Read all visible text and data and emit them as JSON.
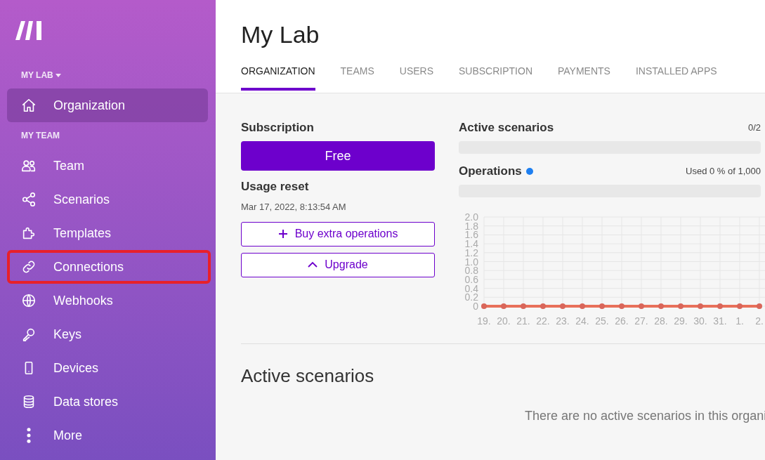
{
  "sidebar": {
    "org_label": "MY LAB",
    "team_label": "MY TEAM",
    "org_items": [
      {
        "label": "Organization",
        "selected": true,
        "highlighted": false
      }
    ],
    "team_items": [
      {
        "label": "Team",
        "selected": false,
        "highlighted": false
      },
      {
        "label": "Scenarios",
        "selected": false,
        "highlighted": false
      },
      {
        "label": "Templates",
        "selected": false,
        "highlighted": false
      },
      {
        "label": "Connections",
        "selected": false,
        "highlighted": true
      },
      {
        "label": "Webhooks",
        "selected": false,
        "highlighted": false
      },
      {
        "label": "Keys",
        "selected": false,
        "highlighted": false
      },
      {
        "label": "Devices",
        "selected": false,
        "highlighted": false
      },
      {
        "label": "Data stores",
        "selected": false,
        "highlighted": false
      },
      {
        "label": "More",
        "selected": false,
        "highlighted": false
      }
    ]
  },
  "page": {
    "title": "My Lab",
    "tabs": [
      {
        "label": "ORGANIZATION",
        "selected": true
      },
      {
        "label": "TEAMS",
        "selected": false
      },
      {
        "label": "USERS",
        "selected": false
      },
      {
        "label": "SUBSCRIPTION",
        "selected": false
      },
      {
        "label": "PAYMENTS",
        "selected": false
      },
      {
        "label": "INSTALLED APPS",
        "selected": false
      }
    ]
  },
  "subscription": {
    "heading": "Subscription",
    "plan": "Free",
    "reset_heading": "Usage reset",
    "reset_time": "Mar 17, 2022, 8:13:54 AM",
    "buttons": [
      {
        "label": "Buy extra operations",
        "kind": "plus"
      },
      {
        "label": "Upgrade",
        "kind": "caret"
      }
    ]
  },
  "active_scenarios_meter": {
    "label": "Active scenarios",
    "reading": "0/2",
    "level": 0
  },
  "operations_meter": {
    "label": "Operations",
    "reading": "Used 0 % of 1,000",
    "level": 0,
    "chart_data": {
      "type": "line",
      "categories": [
        "19.",
        "20.",
        "21.",
        "22.",
        "23.",
        "24.",
        "25.",
        "26.",
        "27.",
        "28.",
        "29.",
        "30.",
        "31.",
        "1.",
        "2."
      ],
      "grid": true,
      "series": [
        {
          "color": "#e8705a",
          "marker": true,
          "values": [
            0,
            0,
            0,
            0,
            0,
            0,
            0,
            0,
            0,
            0,
            0,
            0,
            0,
            0,
            0
          ]
        }
      ],
      "ylim": [
        0,
        2
      ],
      "yticks": [
        0,
        0.2,
        0.4,
        0.6,
        0.8,
        {
          "value": 1,
          "label": "1.0"
        },
        1.2,
        1.4,
        1.6,
        1.8,
        {
          "value": 2,
          "label": "2.0"
        }
      ]
    }
  },
  "active_scenarios": {
    "heading": "Active scenarios",
    "empty_message": "There are no active scenarios in this organi"
  }
}
